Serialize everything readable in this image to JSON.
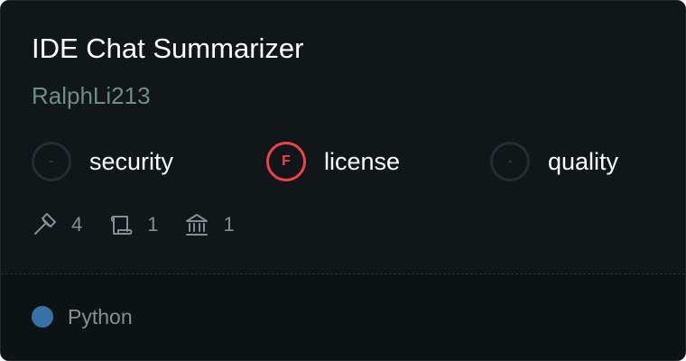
{
  "repo": {
    "title": "IDE Chat Summarizer",
    "owner": "RalphLi213"
  },
  "metrics": [
    {
      "grade": "-",
      "label": "security",
      "icon": "dash-grade-icon",
      "color": "#3c4448"
    },
    {
      "grade": "F",
      "label": "license",
      "icon": "fail-grade-icon",
      "color": "#f0414a"
    },
    {
      "grade": "-",
      "label": "quality",
      "icon": "dash-grade-icon",
      "color": "#3c4448"
    }
  ],
  "stats": {
    "tools": {
      "icon": "hammer-icon",
      "value": "4"
    },
    "prompts": {
      "icon": "scroll-icon",
      "value": "1"
    },
    "resources": {
      "icon": "bank-icon",
      "value": "1"
    }
  },
  "language": {
    "name": "Python",
    "color": "#3572a5"
  }
}
